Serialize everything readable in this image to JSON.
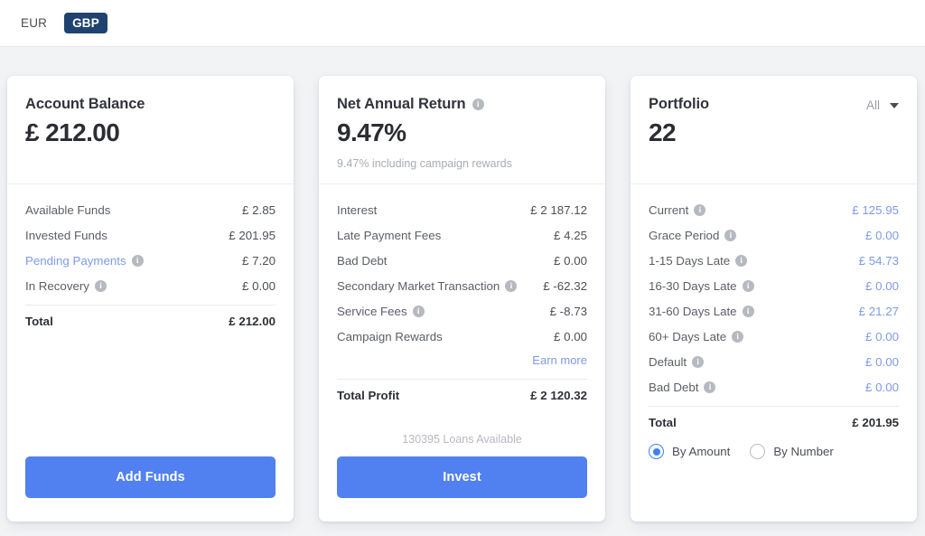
{
  "topbar": {
    "currencies": [
      {
        "label": "EUR",
        "active": false
      },
      {
        "label": "GBP",
        "active": true
      }
    ],
    "active_currency": "GBP",
    "active_bg": "#1f4370"
  },
  "colors": {
    "accent_button": "#5180f1",
    "link": "#7d9ae8",
    "radio_selected": "#3b82f6",
    "page_bg": "#f2f3f5",
    "card_bg": "#ffffff"
  },
  "cards": {
    "account_balance": {
      "title": "Account Balance",
      "amount": "£ 212.00",
      "rows": [
        {
          "label": "Available Funds",
          "value": "£ 2.85",
          "info": false,
          "link_label": false
        },
        {
          "label": "Invested Funds",
          "value": "£ 201.95",
          "info": false,
          "link_label": false
        },
        {
          "label": "Pending Payments",
          "value": "£ 7.20",
          "info": true,
          "link_label": true
        },
        {
          "label": "In Recovery",
          "value": "£ 0.00",
          "info": true,
          "link_label": false
        }
      ],
      "total_label": "Total",
      "total_value": "£ 212.00",
      "button_label": "Add Funds"
    },
    "net_annual_return": {
      "title": "Net Annual Return",
      "title_info": true,
      "amount": "9.47%",
      "subtitle": "9.47% including campaign rewards",
      "rows": [
        {
          "label": "Interest",
          "value": "£ 2 187.12",
          "info": false
        },
        {
          "label": "Late Payment Fees",
          "value": "£ 4.25",
          "info": false
        },
        {
          "label": "Bad Debt",
          "value": "£ 0.00",
          "info": false
        },
        {
          "label": "Secondary Market Transaction",
          "value": "£ -62.32",
          "info": true
        },
        {
          "label": "Service Fees",
          "value": "£ -8.73",
          "info": true
        },
        {
          "label": "Campaign Rewards",
          "value": "£ 0.00",
          "info": false
        }
      ],
      "earn_more_label": "Earn more",
      "total_label": "Total Profit",
      "total_value": "£ 2 120.32",
      "loans_note": "130395 Loans Available",
      "button_label": "Invest"
    },
    "portfolio": {
      "title": "Portfolio",
      "filter_label": "All",
      "amount": "22",
      "rows": [
        {
          "label": "Current",
          "value": "£ 125.95",
          "info": true
        },
        {
          "label": "Grace Period",
          "value": "£ 0.00",
          "info": true
        },
        {
          "label": "1-15 Days Late",
          "value": "£ 54.73",
          "info": true
        },
        {
          "label": "16-30 Days Late",
          "value": "£ 0.00",
          "info": true
        },
        {
          "label": "31-60 Days Late",
          "value": "£ 21.27",
          "info": true
        },
        {
          "label": "60+ Days Late",
          "value": "£ 0.00",
          "info": true
        },
        {
          "label": "Default",
          "value": "£ 0.00",
          "info": true
        },
        {
          "label": "Bad Debt",
          "value": "£ 0.00",
          "info": true
        }
      ],
      "total_label": "Total",
      "total_value": "£ 201.95",
      "radios": [
        {
          "label": "By Amount",
          "selected": true
        },
        {
          "label": "By Number",
          "selected": false
        }
      ]
    }
  }
}
